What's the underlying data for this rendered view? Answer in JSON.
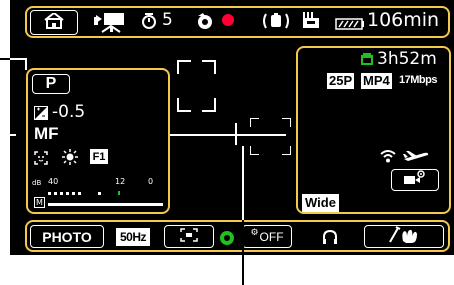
{
  "top_bar": {
    "home_icon": "home-icon",
    "mode_icon": "movie-camera-icon",
    "self_timer_icon": "self-timer-icon",
    "self_timer_value": "5",
    "record_mode_icon": "flash-icon",
    "record_icon": "record-dot-icon",
    "stabilizer_icon": "image-stabilizer-icon",
    "wind_icon": "wind-filter-icon",
    "battery_icon": "battery-icon",
    "battery_time": "106min"
  },
  "left_panel": {
    "program_label": "P",
    "exposure_value": "-0.5",
    "focus_label": "MF",
    "icons": [
      "face-detection-icon",
      "white-balance-sun-icon",
      "f1-icon"
    ],
    "audio_meter": {
      "db_label": "dB",
      "ticks": [
        "40",
        "12",
        "0"
      ],
      "m_label": "M"
    }
  },
  "right_panel": {
    "card_icon": "sd-card-icon",
    "remaining_time": "3h52m",
    "frame_rate": "25P",
    "format": "MP4",
    "bitrate": "17Mbps",
    "wifi_icon": "wifi-icon",
    "gps_icon": "aircraft-icon",
    "camera_settings_icon": "video-settings-icon",
    "zoom_label": "Wide"
  },
  "bottom_bar": {
    "photo_label": "PHOTO",
    "flicker_label": "50Hz",
    "af_frame_icon": "af-frame-icon",
    "green_dot_icon": "green-dot-icon",
    "off_label": "OFF",
    "headphone_icon": "headphone-icon",
    "touch_icon": "touch-decoration-icon"
  },
  "colors": {
    "accent": "#f2c94c",
    "record": "#ff0033",
    "card_green": "#20c020"
  }
}
